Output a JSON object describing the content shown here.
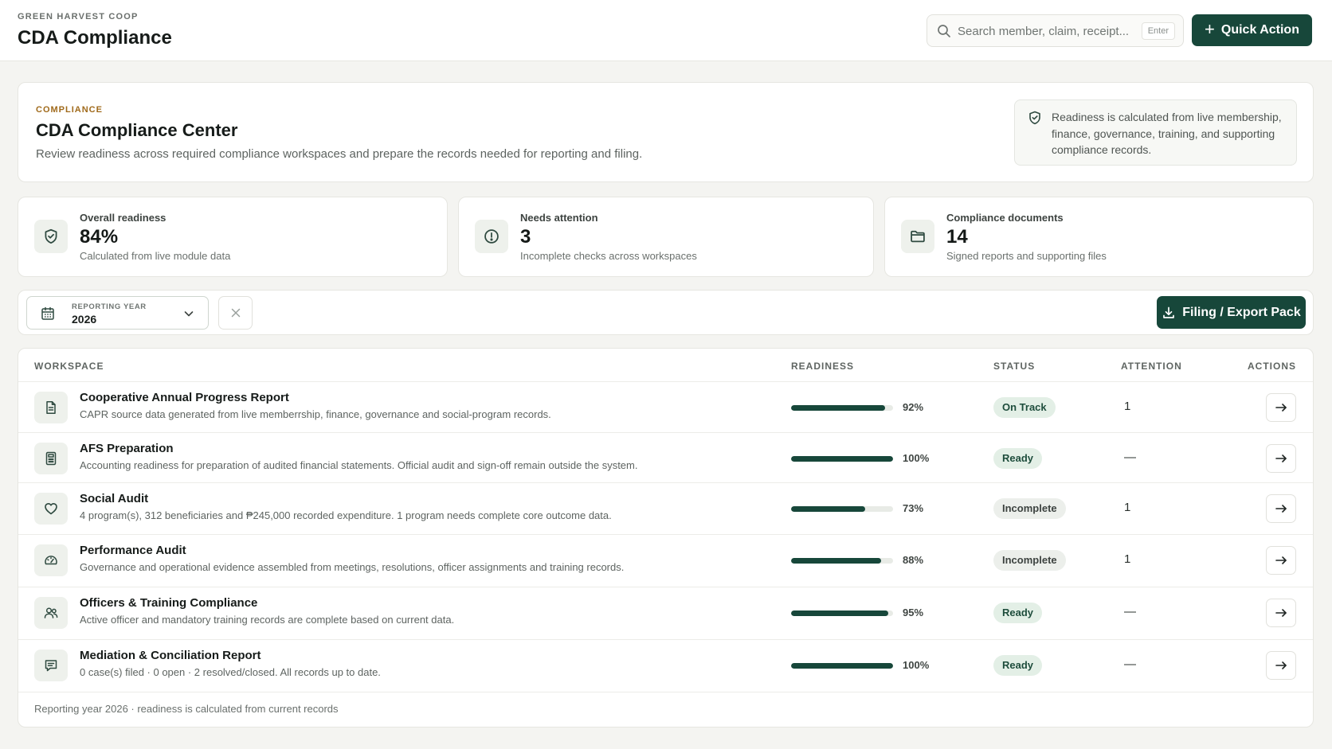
{
  "header": {
    "org_name": "GREEN HARVEST COOP",
    "title": "CDA Compliance",
    "search_placeholder": "Search member, claim, receipt...",
    "search_shortcut": "Enter",
    "quick_action_label": "Quick Action"
  },
  "hero": {
    "kicker": "COMPLIANCE",
    "title": "CDA Compliance Center",
    "description": "Review readiness across required compliance workspaces and prepare the records needed for reporting and filing.",
    "note": "Readiness is calculated from live membership, finance, governance, training, and supporting compliance records."
  },
  "stats": [
    {
      "label": "Overall readiness",
      "value": "84%",
      "sub": "Calculated from live module data",
      "icon": "shield-check-icon"
    },
    {
      "label": "Needs attention",
      "value": "3",
      "sub": "Incomplete checks across workspaces",
      "icon": "alert-circle-icon"
    },
    {
      "label": "Compliance documents",
      "value": "14",
      "sub": "Signed reports and supporting files",
      "icon": "folder-icon"
    }
  ],
  "filters": {
    "year_label": "REPORTING YEAR",
    "year_value": "2026",
    "export_label": "Filing / Export Pack"
  },
  "table": {
    "columns": [
      "WORKSPACE",
      "READINESS",
      "STATUS",
      "ATTENTION",
      "ACTIONS"
    ],
    "rows": [
      {
        "title": "Cooperative Annual Progress Report",
        "desc": "CAPR source data generated from live memberrship, finance, governance and social-program records.",
        "readiness": 92,
        "readiness_label": "92%",
        "status": "On Track",
        "status_kind": "track",
        "attention": "1",
        "icon": "document-icon"
      },
      {
        "title": "AFS Preparation",
        "desc": "Accounting readiness for preparation of audited financial statements. Official audit and sign-off remain outside the system.",
        "readiness": 100,
        "readiness_label": "100%",
        "status": "Ready",
        "status_kind": "ready",
        "attention": "—",
        "icon": "calculator-icon"
      },
      {
        "title": "Social Audit",
        "desc": "4 program(s), 312 beneficiaries and ₱245,000 recorded expenditure. 1 program needs complete core outcome data.",
        "readiness": 73,
        "readiness_label": "73%",
        "status": "Incomplete",
        "status_kind": "incomplete",
        "attention": "1",
        "icon": "heart-icon"
      },
      {
        "title": "Performance Audit",
        "desc": "Governance and operational evidence assembled from meetings, resolutions, officer assignments and training records.",
        "readiness": 88,
        "readiness_label": "88%",
        "status": "Incomplete",
        "status_kind": "incomplete",
        "attention": "1",
        "icon": "gauge-icon"
      },
      {
        "title": "Officers & Training Compliance",
        "desc": "Active officer and mandatory training records are complete based on current data.",
        "readiness": 95,
        "readiness_label": "95%",
        "status": "Ready",
        "status_kind": "ready",
        "attention": "—",
        "icon": "users-icon"
      },
      {
        "title": "Mediation & Conciliation Report",
        "desc": "0 case(s) filed · 0 open · 2 resolved/closed. All records up to date.",
        "readiness": 100,
        "readiness_label": "100%",
        "status": "Ready",
        "status_kind": "ready",
        "attention": "—",
        "icon": "message-icon"
      }
    ],
    "footer": "Reporting year 2026 · readiness is calculated from current records"
  },
  "colors": {
    "brand": "#17473a",
    "accent_kicker": "#a06a1b",
    "badge_ready_bg": "#e3efe6",
    "badge_incomplete_bg": "#ecefeb"
  }
}
